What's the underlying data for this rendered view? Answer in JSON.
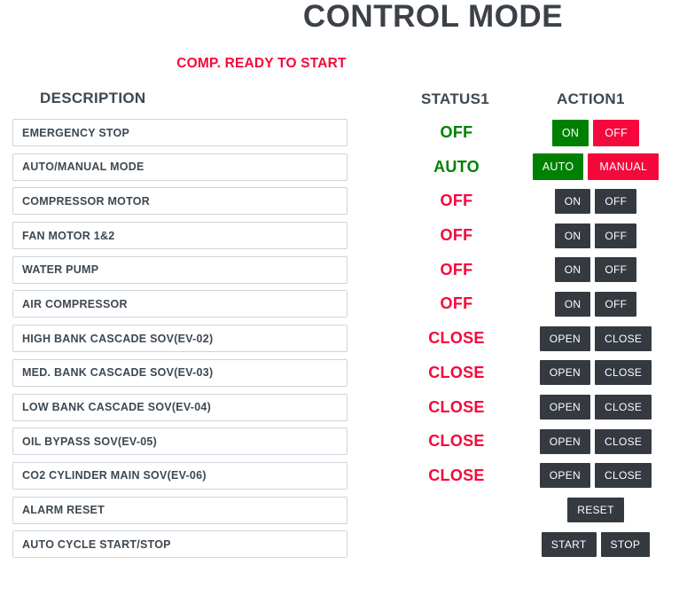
{
  "header": {
    "title": "CONTROL MODE",
    "banner": "COMP. READY TO START"
  },
  "columns": {
    "description": "DESCRIPTION",
    "status": "STATUS1",
    "action": "ACTION1"
  },
  "colors": {
    "title": "#3b4147",
    "alert_red": "#f5083b",
    "status_green": "#008000",
    "status_red": "#f5083b",
    "button_dark": "#343a40",
    "button_green": "#008000",
    "button_red": "#f5083b",
    "box_border": "#ced4da",
    "text": "#3d4852"
  },
  "rows": [
    {
      "description": "EMERGENCY STOP",
      "status": "OFF",
      "status_color": "green",
      "actions": [
        {
          "label": "ON",
          "style": "green"
        },
        {
          "label": "OFF",
          "style": "red"
        }
      ]
    },
    {
      "description": "AUTO/MANUAL MODE",
      "status": "AUTO",
      "status_color": "green",
      "actions": [
        {
          "label": "AUTO",
          "style": "green"
        },
        {
          "label": "MANUAL",
          "style": "red"
        }
      ]
    },
    {
      "description": "COMPRESSOR MOTOR",
      "status": "OFF",
      "status_color": "red",
      "actions": [
        {
          "label": "ON",
          "style": "dark"
        },
        {
          "label": "OFF",
          "style": "dark"
        }
      ]
    },
    {
      "description": "FAN MOTOR 1&2",
      "status": "OFF",
      "status_color": "red",
      "actions": [
        {
          "label": "ON",
          "style": "dark"
        },
        {
          "label": "OFF",
          "style": "dark"
        }
      ]
    },
    {
      "description": "WATER PUMP",
      "status": "OFF",
      "status_color": "red",
      "actions": [
        {
          "label": "ON",
          "style": "dark"
        },
        {
          "label": "OFF",
          "style": "dark"
        }
      ]
    },
    {
      "description": "AIR COMPRESSOR",
      "status": "OFF",
      "status_color": "red",
      "actions": [
        {
          "label": "ON",
          "style": "dark"
        },
        {
          "label": "OFF",
          "style": "dark"
        }
      ]
    },
    {
      "description": "HIGH BANK CASCADE SOV(EV-02)",
      "status": "CLOSE",
      "status_color": "red",
      "actions": [
        {
          "label": "OPEN",
          "style": "dark"
        },
        {
          "label": "CLOSE",
          "style": "dark"
        }
      ]
    },
    {
      "description": "MED. BANK CASCADE SOV(EV-03)",
      "status": "CLOSE",
      "status_color": "red",
      "actions": [
        {
          "label": "OPEN",
          "style": "dark"
        },
        {
          "label": "CLOSE",
          "style": "dark"
        }
      ]
    },
    {
      "description": "LOW BANK CASCADE SOV(EV-04)",
      "status": "CLOSE",
      "status_color": "red",
      "actions": [
        {
          "label": "OPEN",
          "style": "dark"
        },
        {
          "label": "CLOSE",
          "style": "dark"
        }
      ]
    },
    {
      "description": "OIL BYPASS SOV(EV-05)",
      "status": "CLOSE",
      "status_color": "red",
      "actions": [
        {
          "label": "OPEN",
          "style": "dark"
        },
        {
          "label": "CLOSE",
          "style": "dark"
        }
      ]
    },
    {
      "description": "CO2 CYLINDER MAIN SOV(EV-06)",
      "status": "CLOSE",
      "status_color": "red",
      "actions": [
        {
          "label": "OPEN",
          "style": "dark"
        },
        {
          "label": "CLOSE",
          "style": "dark"
        }
      ]
    },
    {
      "description": "ALARM RESET",
      "status": "",
      "status_color": "red",
      "actions": [
        {
          "label": "RESET",
          "style": "dark"
        }
      ]
    },
    {
      "description": "AUTO CYCLE START/STOP",
      "status": "",
      "status_color": "red",
      "actions": [
        {
          "label": "START",
          "style": "dark"
        },
        {
          "label": "STOP",
          "style": "dark"
        }
      ]
    }
  ]
}
